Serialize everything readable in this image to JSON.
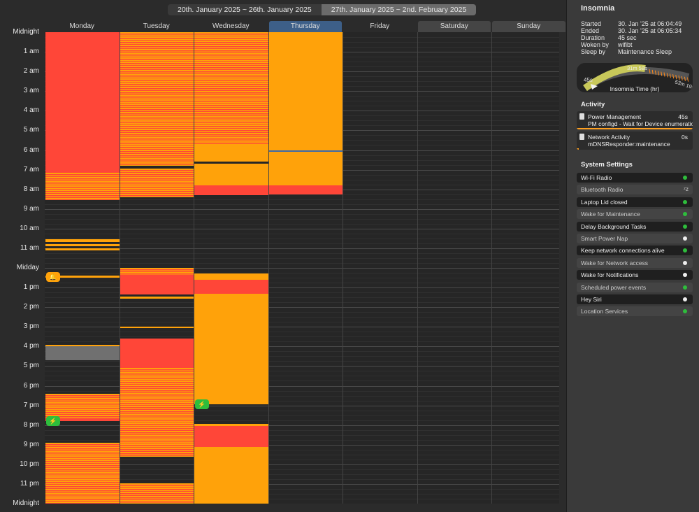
{
  "weeks": [
    {
      "label": "20th. January 2025 ~ 26th. January 2025",
      "selected": false
    },
    {
      "label": "27th. January 2025 ~ 2nd. February 2025",
      "selected": true
    }
  ],
  "days": [
    {
      "label": "Monday",
      "style": "normal"
    },
    {
      "label": "Tuesday",
      "style": "normal"
    },
    {
      "label": "Wednesday",
      "style": "normal"
    },
    {
      "label": "Thursday",
      "style": "highlight"
    },
    {
      "label": "Friday",
      "style": "normal"
    },
    {
      "label": "Saturday",
      "style": "weekend"
    },
    {
      "label": "Sunday",
      "style": "weekend"
    }
  ],
  "hours": [
    "Midnight",
    "1 am",
    "2 am",
    "3 am",
    "4 am",
    "5 am",
    "6 am",
    "7 am",
    "8 am",
    "9 am",
    "10 am",
    "11 am",
    "Midday",
    "1 pm",
    "2 pm",
    "3 pm",
    "4 pm",
    "5 pm",
    "6 pm",
    "7 pm",
    "8 pm",
    "9 pm",
    "10 pm",
    "11 pm",
    "Midnight"
  ],
  "colors": {
    "red": "#ff4638",
    "orange": "#ffa20a",
    "gray": "#707070",
    "green": "#2ebd3c",
    "highlight": "#3d5f88"
  },
  "activity_blocks": [
    {
      "day": 0,
      "start": 0.0,
      "end": 7.15,
      "kind": "red"
    },
    {
      "day": 0,
      "start": 7.15,
      "end": 8.55,
      "kind": "stripe"
    },
    {
      "day": 0,
      "start": 10.55,
      "end": 10.7,
      "kind": "orange"
    },
    {
      "day": 0,
      "start": 10.8,
      "end": 10.9,
      "kind": "orange"
    },
    {
      "day": 0,
      "start": 11.0,
      "end": 11.1,
      "kind": "orange"
    },
    {
      "day": 0,
      "start": 12.4,
      "end": 12.5,
      "kind": "orange"
    },
    {
      "day": 0,
      "start": 15.9,
      "end": 16.0,
      "kind": "orange"
    },
    {
      "day": 0,
      "start": 16.0,
      "end": 16.7,
      "kind": "gray"
    },
    {
      "day": 0,
      "start": 18.4,
      "end": 19.7,
      "kind": "stripe"
    },
    {
      "day": 0,
      "start": 19.7,
      "end": 19.8,
      "kind": "red"
    },
    {
      "day": 0,
      "start": 20.9,
      "end": 24.0,
      "kind": "stripe"
    },
    {
      "day": 1,
      "start": 0.0,
      "end": 6.8,
      "kind": "stripe"
    },
    {
      "day": 1,
      "start": 6.95,
      "end": 8.4,
      "kind": "stripe"
    },
    {
      "day": 1,
      "start": 12.0,
      "end": 12.35,
      "kind": "stripe"
    },
    {
      "day": 1,
      "start": 12.35,
      "end": 13.35,
      "kind": "red"
    },
    {
      "day": 1,
      "start": 13.45,
      "end": 13.55,
      "kind": "orange"
    },
    {
      "day": 1,
      "start": 15.0,
      "end": 15.05,
      "kind": "orange"
    },
    {
      "day": 1,
      "start": 15.6,
      "end": 17.1,
      "kind": "red"
    },
    {
      "day": 1,
      "start": 17.1,
      "end": 21.6,
      "kind": "stripe"
    },
    {
      "day": 1,
      "start": 22.95,
      "end": 24.0,
      "kind": "stripe"
    },
    {
      "day": 2,
      "start": 0.0,
      "end": 5.7,
      "kind": "stripe"
    },
    {
      "day": 2,
      "start": 5.7,
      "end": 6.6,
      "kind": "orange"
    },
    {
      "day": 2,
      "start": 6.7,
      "end": 7.8,
      "kind": "orange"
    },
    {
      "day": 2,
      "start": 7.8,
      "end": 8.3,
      "kind": "red"
    },
    {
      "day": 2,
      "start": 12.3,
      "end": 12.6,
      "kind": "orange"
    },
    {
      "day": 2,
      "start": 12.6,
      "end": 13.3,
      "kind": "red"
    },
    {
      "day": 2,
      "start": 13.3,
      "end": 18.95,
      "kind": "orange"
    },
    {
      "day": 2,
      "start": 19.95,
      "end": 20.05,
      "kind": "orange"
    },
    {
      "day": 2,
      "start": 20.05,
      "end": 21.1,
      "kind": "red"
    },
    {
      "day": 2,
      "start": 21.1,
      "end": 24.0,
      "kind": "orange"
    },
    {
      "day": 3,
      "start": 0.0,
      "end": 6.0,
      "kind": "orange"
    },
    {
      "day": 3,
      "start": 6.0,
      "end": 6.1,
      "kind": "blue"
    },
    {
      "day": 3,
      "start": 6.1,
      "end": 7.8,
      "kind": "orange"
    },
    {
      "day": 3,
      "start": 7.8,
      "end": 8.25,
      "kind": "red"
    }
  ],
  "badges": [
    {
      "day": 0,
      "time": 12.45,
      "color": "orange",
      "icon": "bell-icon",
      "glyph": "🔔"
    },
    {
      "day": 0,
      "time": 19.8,
      "color": "green",
      "icon": "charger-icon",
      "glyph": "⚡"
    },
    {
      "day": 2,
      "time": 18.95,
      "color": "green",
      "icon": "plug-icon",
      "glyph": "⚡"
    }
  ],
  "sidebar": {
    "title": "Insomnia",
    "info": [
      {
        "key": "Started",
        "value": "30. Jan '25 at 06:04:49"
      },
      {
        "key": "Ended",
        "value": "30. Jan '25 at 06:05:34"
      },
      {
        "key": "Duration",
        "value": "45 sec"
      },
      {
        "key": "Woken by",
        "value": "wifibt"
      },
      {
        "key": "Sleep by",
        "value": "Maintenance Sleep"
      }
    ],
    "gauge": {
      "left_label": "45s",
      "top_label": "31m 58s",
      "right_label": "53m 19s",
      "caption": "Insomnia Time (hr)",
      "fill_fraction": 0.45
    },
    "activity_title": "Activity",
    "activity": [
      {
        "title": "Power Management",
        "value": "45s",
        "detail": "PM configd - Wait for Device enumeration",
        "bar_fraction": 1.0
      },
      {
        "title": "Network Activity",
        "value": "0s",
        "detail": "mDNSResponder:maintenance",
        "bar_fraction": 0.02
      }
    ],
    "settings_title": "System Settings",
    "settings": [
      {
        "label": "Wi-Fi Radio",
        "state": "green",
        "style": "dark"
      },
      {
        "label": "Bluetooth Radio",
        "state": "zz",
        "style": "light"
      },
      {
        "label": "Laptop Lid closed",
        "state": "green",
        "style": "dark"
      },
      {
        "label": "Wake for Maintenance",
        "state": "green",
        "style": "light"
      },
      {
        "label": "Delay Background Tasks",
        "state": "green",
        "style": "dark"
      },
      {
        "label": "Smart Power Nap",
        "state": "white",
        "style": "light"
      },
      {
        "label": "Keep network connections alive",
        "state": "green",
        "style": "dark"
      },
      {
        "label": "Wake for Network access",
        "state": "white",
        "style": "light"
      },
      {
        "label": "Wake for Notifications",
        "state": "white",
        "style": "dark"
      },
      {
        "label": "Scheduled power events",
        "state": "green",
        "style": "light"
      },
      {
        "label": "Hey Siri",
        "state": "white",
        "style": "dark"
      },
      {
        "label": "Location Services",
        "state": "green",
        "style": "light"
      }
    ]
  }
}
